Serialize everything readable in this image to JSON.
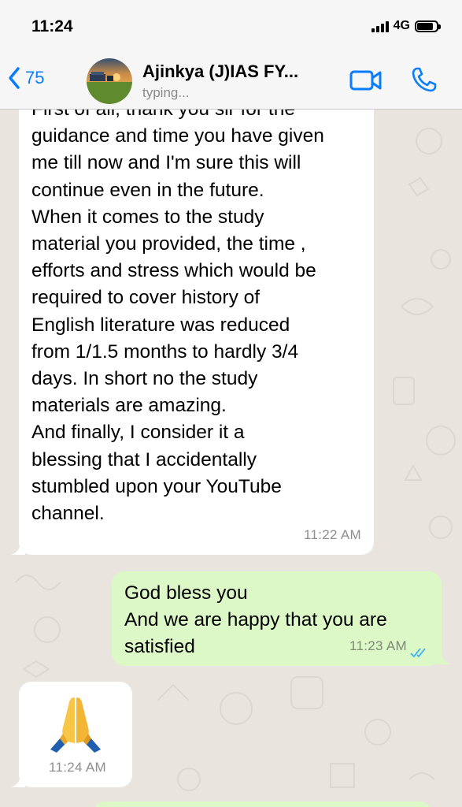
{
  "status_bar": {
    "time": "11:24",
    "network": "4G"
  },
  "header": {
    "back_count": "75",
    "contact_name": "Ajinkya (J)IAS FY...",
    "status": "typing..."
  },
  "messages": [
    {
      "direction": "incoming",
      "text": "First of all, thank you sir for the\nguidance and time you have given\nme till now and I'm sure this will\ncontinue even in the future.\nWhen it comes to the study\nmaterial you provided, the time ,\nefforts and stress which would be\nrequired to cover history of\nEnglish literature was reduced\nfrom 1/1.5 months to hardly 3/4\ndays. In short no the study\nmaterials are amazing.\nAnd finally, I consider it a\nblessing that I accidentally\nstumbled upon your YouTube\nchannel.",
      "time": "11:22 AM"
    },
    {
      "direction": "outgoing",
      "text": "God bless you\nAnd we are happy that you are\nsatisfied",
      "time": "11:23 AM",
      "read": true
    },
    {
      "direction": "incoming",
      "emoji": "folded-hands",
      "time": "11:24 AM"
    }
  ],
  "colors": {
    "accent": "#0a7cff",
    "incoming_bubble": "#ffffff",
    "outgoing_bubble": "#dcf8c6",
    "wallpaper": "#e9e5de",
    "read_ticks": "#4fb6ec"
  }
}
